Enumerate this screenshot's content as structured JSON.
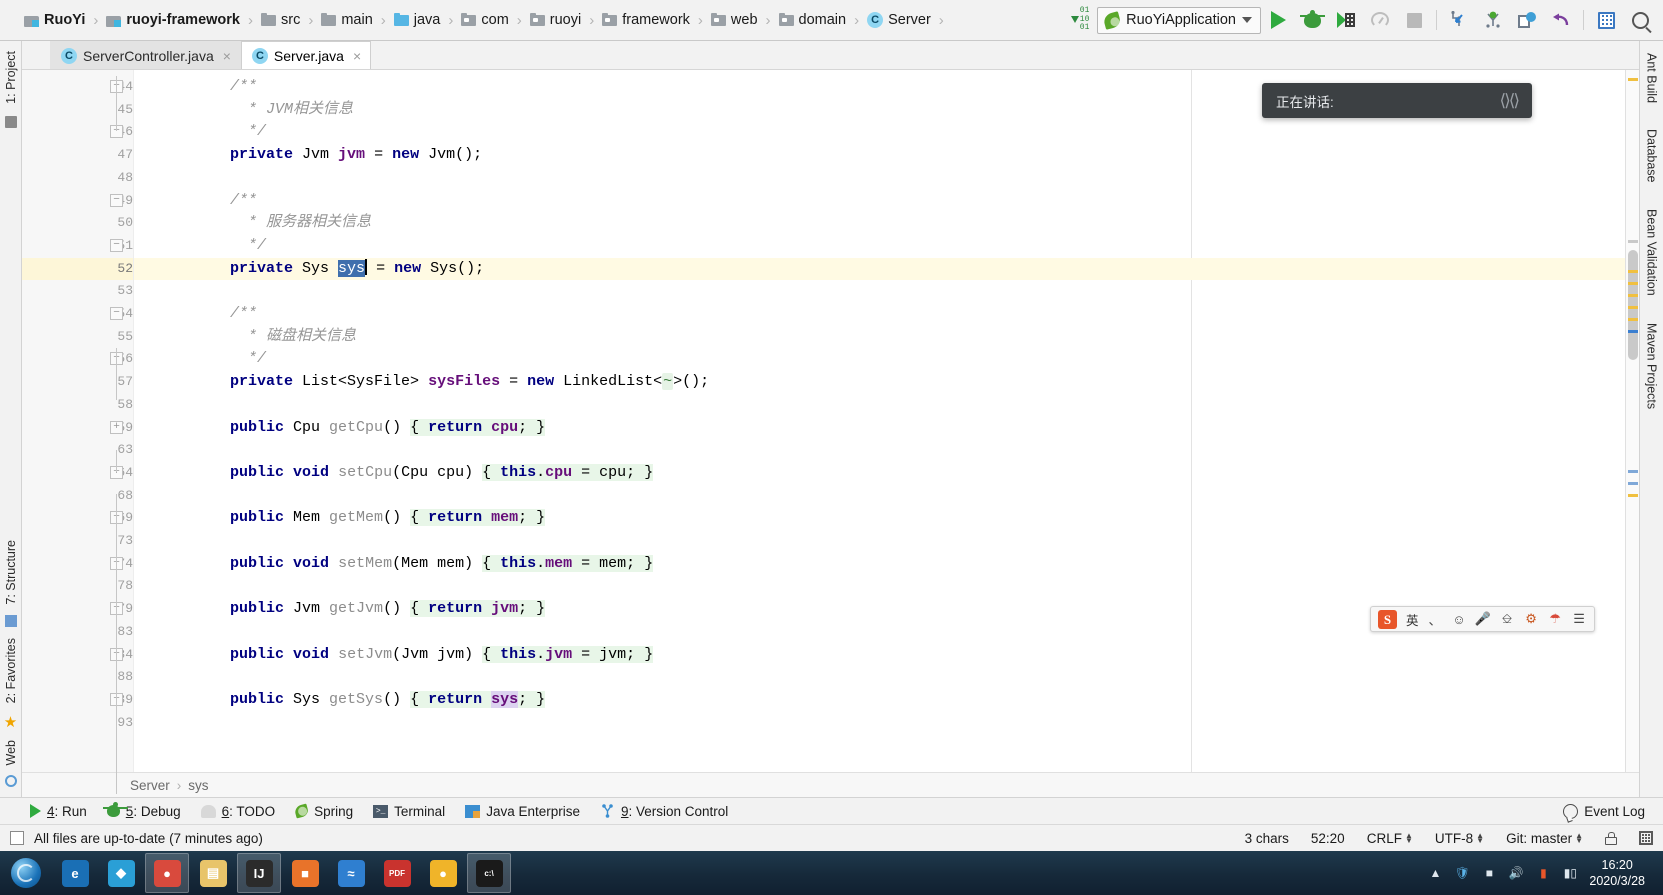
{
  "toolbar": {
    "breadcrumbs": [
      {
        "label": "RuoYi",
        "icon": "module-icon",
        "bold": true
      },
      {
        "label": "ruoyi-framework",
        "icon": "module-icon",
        "bold": true
      },
      {
        "label": "src",
        "icon": "folder-icon",
        "bold": false
      },
      {
        "label": "main",
        "icon": "folder-icon",
        "bold": false
      },
      {
        "label": "java",
        "icon": "source-folder-icon",
        "bold": false
      },
      {
        "label": "com",
        "icon": "package-icon",
        "bold": false
      },
      {
        "label": "ruoyi",
        "icon": "package-icon",
        "bold": false
      },
      {
        "label": "framework",
        "icon": "package-icon",
        "bold": false
      },
      {
        "label": "web",
        "icon": "package-icon",
        "bold": false
      },
      {
        "label": "domain",
        "icon": "package-icon",
        "bold": false
      },
      {
        "label": "Server",
        "icon": "class-icon",
        "bold": false
      }
    ],
    "separator": "›",
    "run_config": "RuoYiApplication",
    "buttons": [
      "compile-button",
      "run-button",
      "debug-button",
      "run-with-coverage-button",
      "profile-button",
      "stop-button",
      "update-project-button",
      "commit-button",
      "show-history-button",
      "rollback-button",
      "database-button",
      "search-everywhere-button"
    ]
  },
  "editor_tabs": [
    {
      "label": "ServerController.java",
      "active": false,
      "close": "×"
    },
    {
      "label": "Server.java",
      "active": true,
      "close": "×"
    }
  ],
  "code": {
    "current_line": 52,
    "lines": [
      {
        "num": "44",
        "fold": "−",
        "indent": 4,
        "tokens": [
          {
            "t": "/**",
            "c": "cmt"
          }
        ]
      },
      {
        "num": "45",
        "indent": 5,
        "tokens": [
          {
            "t": "* JVM相关信息",
            "c": "cmt"
          }
        ]
      },
      {
        "num": "46",
        "fold": "−",
        "indent": 5,
        "tokens": [
          {
            "t": "*/",
            "c": "cmt"
          }
        ]
      },
      {
        "num": "47",
        "indent": 4,
        "tokens": [
          {
            "t": "private",
            "c": "kw"
          },
          {
            "t": " Jvm ",
            "c": "typ"
          },
          {
            "t": "jvm",
            "c": "fld"
          },
          {
            "t": " = ",
            "c": "typ"
          },
          {
            "t": "new",
            "c": "kw"
          },
          {
            "t": " Jvm();",
            "c": "typ"
          }
        ]
      },
      {
        "num": "48",
        "indent": 0,
        "tokens": []
      },
      {
        "num": "49",
        "fold": "−",
        "indent": 4,
        "tokens": [
          {
            "t": "/**",
            "c": "cmt"
          }
        ]
      },
      {
        "num": "50",
        "indent": 5,
        "tokens": [
          {
            "t": "* 服务器相关信息",
            "c": "cmt"
          }
        ]
      },
      {
        "num": "51",
        "fold": "−",
        "bulb": true,
        "indent": 5,
        "tokens": [
          {
            "t": "*/",
            "c": "cmt"
          }
        ]
      },
      {
        "num": "52",
        "current": true,
        "indent": 4,
        "tokens": [
          {
            "t": "private",
            "c": "kw"
          },
          {
            "t": " Sys ",
            "c": "typ"
          },
          {
            "t": "sys",
            "c": "sel"
          },
          {
            "t": "CARET",
            "c": "caret"
          },
          {
            "t": " = ",
            "c": "typ"
          },
          {
            "t": "new",
            "c": "kw"
          },
          {
            "t": " Sys();",
            "c": "typ"
          }
        ]
      },
      {
        "num": "53",
        "indent": 0,
        "tokens": []
      },
      {
        "num": "54",
        "fold": "−",
        "indent": 4,
        "tokens": [
          {
            "t": "/**",
            "c": "cmt"
          }
        ]
      },
      {
        "num": "55",
        "indent": 5,
        "tokens": [
          {
            "t": "* 磁盘相关信息",
            "c": "cmt"
          }
        ]
      },
      {
        "num": "56",
        "fold": "−",
        "indent": 5,
        "tokens": [
          {
            "t": "*/",
            "c": "cmt"
          }
        ]
      },
      {
        "num": "57",
        "indent": 4,
        "tokens": [
          {
            "t": "private",
            "c": "kw"
          },
          {
            "t": " List<SysFile> ",
            "c": "typ"
          },
          {
            "t": "sysFiles",
            "c": "fld"
          },
          {
            "t": " = ",
            "c": "typ"
          },
          {
            "t": "new",
            "c": "kw"
          },
          {
            "t": " LinkedList<",
            "c": "typ"
          },
          {
            "t": "~",
            "c": "genfold"
          },
          {
            "t": ">();",
            "c": "typ"
          }
        ]
      },
      {
        "num": "58",
        "indent": 0,
        "tokens": []
      },
      {
        "num": "59",
        "fold": "+",
        "indent": 4,
        "tokens": [
          {
            "t": "public",
            "c": "kw"
          },
          {
            "t": " Cpu ",
            "c": "typ"
          },
          {
            "t": "getCpu",
            "c": "mth"
          },
          {
            "t": "() ",
            "c": "typ"
          },
          {
            "t": "{ ",
            "c": "fbg"
          },
          {
            "t": "return",
            "c": "kw fbg"
          },
          {
            "t": " ",
            "c": "fbg"
          },
          {
            "t": "cpu",
            "c": "fld fbg"
          },
          {
            "t": "; ",
            "c": "fbg"
          },
          {
            "t": "}",
            "c": "fbg"
          }
        ]
      },
      {
        "num": "63",
        "indent": 0,
        "tokens": []
      },
      {
        "num": "64",
        "fold": "+",
        "indent": 4,
        "tokens": [
          {
            "t": "public",
            "c": "kw"
          },
          {
            "t": " ",
            "c": "typ"
          },
          {
            "t": "void",
            "c": "kw"
          },
          {
            "t": " ",
            "c": "typ"
          },
          {
            "t": "setCpu",
            "c": "mth"
          },
          {
            "t": "(Cpu cpu) ",
            "c": "typ"
          },
          {
            "t": "{ ",
            "c": "fbg"
          },
          {
            "t": "this",
            "c": "kw fbg"
          },
          {
            "t": ".",
            "c": "fbg"
          },
          {
            "t": "cpu",
            "c": "fld fbg"
          },
          {
            "t": " = cpu; ",
            "c": "fbg"
          },
          {
            "t": "}",
            "c": "fbg"
          }
        ]
      },
      {
        "num": "68",
        "indent": 0,
        "tokens": []
      },
      {
        "num": "69",
        "fold": "+",
        "indent": 4,
        "tokens": [
          {
            "t": "public",
            "c": "kw"
          },
          {
            "t": " Mem ",
            "c": "typ"
          },
          {
            "t": "getMem",
            "c": "mth"
          },
          {
            "t": "() ",
            "c": "typ"
          },
          {
            "t": "{ ",
            "c": "fbg"
          },
          {
            "t": "return",
            "c": "kw fbg"
          },
          {
            "t": " ",
            "c": "fbg"
          },
          {
            "t": "mem",
            "c": "fld fbg"
          },
          {
            "t": "; ",
            "c": "fbg"
          },
          {
            "t": "}",
            "c": "fbg"
          }
        ]
      },
      {
        "num": "73",
        "indent": 0,
        "tokens": []
      },
      {
        "num": "74",
        "fold": "+",
        "indent": 4,
        "tokens": [
          {
            "t": "public",
            "c": "kw"
          },
          {
            "t": " ",
            "c": "typ"
          },
          {
            "t": "void",
            "c": "kw"
          },
          {
            "t": " ",
            "c": "typ"
          },
          {
            "t": "setMem",
            "c": "mth"
          },
          {
            "t": "(Mem mem) ",
            "c": "typ"
          },
          {
            "t": "{ ",
            "c": "fbg"
          },
          {
            "t": "this",
            "c": "kw fbg"
          },
          {
            "t": ".",
            "c": "fbg"
          },
          {
            "t": "mem",
            "c": "fld fbg"
          },
          {
            "t": " = mem; ",
            "c": "fbg"
          },
          {
            "t": "}",
            "c": "fbg"
          }
        ]
      },
      {
        "num": "78",
        "indent": 0,
        "tokens": []
      },
      {
        "num": "79",
        "fold": "+",
        "indent": 4,
        "tokens": [
          {
            "t": "public",
            "c": "kw"
          },
          {
            "t": " Jvm ",
            "c": "typ"
          },
          {
            "t": "getJvm",
            "c": "mth"
          },
          {
            "t": "() ",
            "c": "typ"
          },
          {
            "t": "{ ",
            "c": "fbg"
          },
          {
            "t": "return",
            "c": "kw fbg"
          },
          {
            "t": " ",
            "c": "fbg"
          },
          {
            "t": "jvm",
            "c": "fld fbg"
          },
          {
            "t": "; ",
            "c": "fbg"
          },
          {
            "t": "}",
            "c": "fbg"
          }
        ]
      },
      {
        "num": "83",
        "indent": 0,
        "tokens": []
      },
      {
        "num": "84",
        "fold": "+",
        "indent": 4,
        "tokens": [
          {
            "t": "public",
            "c": "kw"
          },
          {
            "t": " ",
            "c": "typ"
          },
          {
            "t": "void",
            "c": "kw"
          },
          {
            "t": " ",
            "c": "typ"
          },
          {
            "t": "setJvm",
            "c": "mth"
          },
          {
            "t": "(Jvm jvm) ",
            "c": "typ"
          },
          {
            "t": "{ ",
            "c": "fbg"
          },
          {
            "t": "this",
            "c": "kw fbg"
          },
          {
            "t": ".",
            "c": "fbg"
          },
          {
            "t": "jvm",
            "c": "fld fbg"
          },
          {
            "t": " = jvm; ",
            "c": "fbg"
          },
          {
            "t": "}",
            "c": "fbg"
          }
        ]
      },
      {
        "num": "88",
        "indent": 0,
        "tokens": []
      },
      {
        "num": "89",
        "fold": "+",
        "indent": 4,
        "tokens": [
          {
            "t": "public",
            "c": "kw"
          },
          {
            "t": " Sys ",
            "c": "typ"
          },
          {
            "t": "getSys",
            "c": "mth"
          },
          {
            "t": "() ",
            "c": "typ"
          },
          {
            "t": "{ ",
            "c": "fbg"
          },
          {
            "t": "return",
            "c": "kw fbg"
          },
          {
            "t": " ",
            "c": "fbg"
          },
          {
            "t": "sys",
            "c": "fld usehl"
          },
          {
            "t": "; ",
            "c": "fbg"
          },
          {
            "t": "}",
            "c": "fbg"
          }
        ]
      },
      {
        "num": "93",
        "indent": 0,
        "tokens": []
      }
    ]
  },
  "left_strip": [
    {
      "label": "1: Project",
      "icon": "project-icon"
    },
    {
      "label": "7: Structure",
      "icon": "structure-icon"
    },
    {
      "label": "2: Favorites",
      "icon": "favorites-icon"
    },
    {
      "label": "Web",
      "icon": "web-icon"
    }
  ],
  "right_strip": [
    {
      "label": "Ant Build",
      "icon": "ant-icon"
    },
    {
      "label": "Database",
      "icon": "database-icon"
    },
    {
      "label": "Bean Validation",
      "icon": "bean-icon"
    },
    {
      "label": "Maven Projects",
      "icon": "maven-icon"
    }
  ],
  "editor_breadcrumb": {
    "class": "Server",
    "member": "sys",
    "separator": "›"
  },
  "tool_windows": [
    {
      "num": "4",
      "label": ": Run",
      "icon": "run-icon"
    },
    {
      "num": "5",
      "label": ": Debug",
      "icon": "debug-icon"
    },
    {
      "num": "6",
      "label": ": TODO",
      "icon": "todo-icon"
    },
    {
      "num": "",
      "label": "Spring",
      "icon": "spring-icon"
    },
    {
      "num": "",
      "label": "Terminal",
      "icon": "terminal-icon"
    },
    {
      "num": "",
      "label": "Java Enterprise",
      "icon": "java-ee-icon"
    },
    {
      "num": "9",
      "label": ": Version Control",
      "icon": "vcs-icon"
    }
  ],
  "event_log": "Event Log",
  "status": {
    "message": "All files are up-to-date (7 minutes ago)",
    "chars": "3 chars",
    "caret": "52:20",
    "line_sep": "CRLF",
    "encoding": "UTF-8",
    "branch": "Git: master",
    "updown": "↕"
  },
  "tooltip": {
    "text": "正在讲话:",
    "wave": "〰"
  },
  "ime": {
    "logo": "S",
    "mode": "英",
    "items": [
      "comma-period-icon",
      "emoji-icon",
      "mic-icon",
      "keyboard-icon",
      "toolbox-icon",
      "umbrella-icon",
      "menu-icon"
    ]
  },
  "taskbar": {
    "start": "start-orb",
    "apps": [
      {
        "name": "internet-explorer",
        "glyph": "e",
        "color": "#1a6fb5"
      },
      {
        "name": "browser-blue",
        "glyph": "◆",
        "color": "#2a9fd6"
      },
      {
        "name": "chrome",
        "glyph": "●",
        "color": "#d94a3d",
        "active": true
      },
      {
        "name": "file-explorer",
        "glyph": "▤",
        "color": "#e8c46a"
      },
      {
        "name": "intellij-idea",
        "glyph": "IJ",
        "color": "#2b2b2b",
        "active": true
      },
      {
        "name": "app-orange",
        "glyph": "■",
        "color": "#e8732a"
      },
      {
        "name": "app-waves",
        "glyph": "≈",
        "color": "#2f7fd0"
      },
      {
        "name": "pdf-reader",
        "glyph": "PDF",
        "color": "#c9332e"
      },
      {
        "name": "app-yellow",
        "glyph": "●",
        "color": "#f0b429"
      },
      {
        "name": "command-prompt",
        "glyph": "c:\\",
        "color": "#1a1a1a",
        "active": true
      }
    ],
    "clock_time": "16:20",
    "clock_date": "2020/3/28"
  }
}
